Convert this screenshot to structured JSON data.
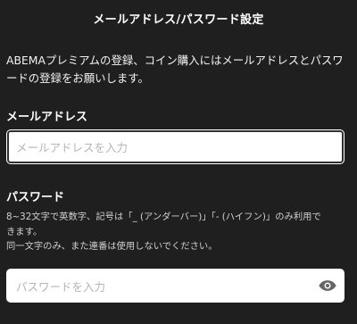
{
  "header": {
    "title": "メールアドレス/パスワード設定"
  },
  "intro": {
    "line1": "ABEMAプレミアムの登録、コイン購入にはメールアドレスとパスワ",
    "line2": "ードの登録をお願いします。"
  },
  "email": {
    "label": "メールアドレス",
    "placeholder": "メールアドレスを入力",
    "value": ""
  },
  "password": {
    "label": "パスワード",
    "help_line1": "8~32文字で英数字、記号は「_ (アンダーバー)」「- (ハイフン)」のみ利用で",
    "help_line2": "きます。",
    "help_line3": "同一文字のみ、また連番は使用しないでください。",
    "placeholder": "パスワードを入力",
    "value": "",
    "toggle_icon": "eye-icon"
  }
}
